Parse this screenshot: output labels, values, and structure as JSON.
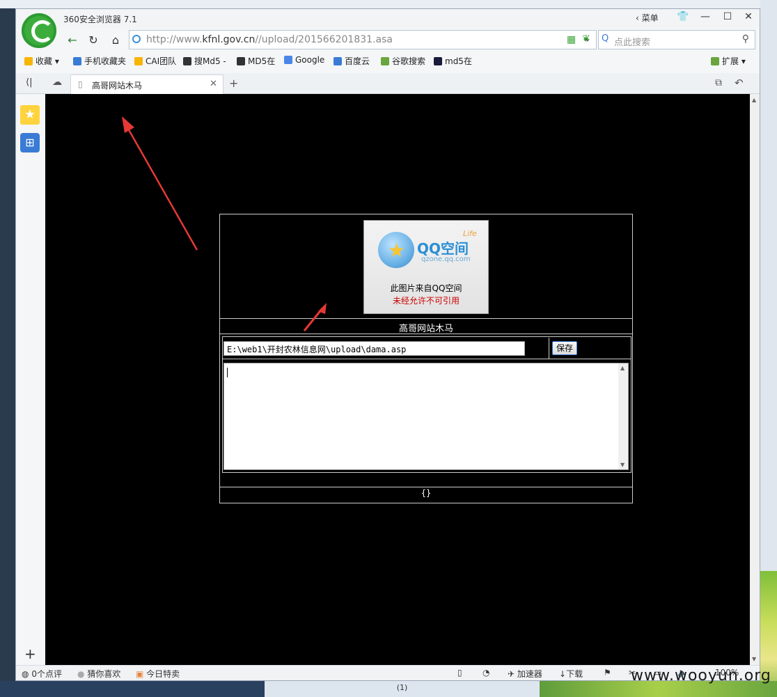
{
  "window": {
    "title": "360安全浏览器 7.1",
    "menu_label": "菜单",
    "controls": {
      "minimize": "—",
      "maximize": "☐",
      "close": "✕"
    }
  },
  "address_bar": {
    "url_prefix": "http://www.",
    "url_domain": "kfnl.gov.cn",
    "url_path": "//upload/201566201831.asa",
    "search_placeholder": "点此搜索"
  },
  "bookmarks": [
    {
      "label": "收藏",
      "icon": "star-icon",
      "color": "#f7b500"
    },
    {
      "label": "手机收藏夹",
      "icon": "phone-icon",
      "color": "#3a7bd5"
    },
    {
      "label": "CAI团队",
      "icon": "badge-icon",
      "color": "#f7b500"
    },
    {
      "label": "搜Md5 -",
      "icon": "new-icon",
      "color": "#333333"
    },
    {
      "label": "MD5在",
      "icon": "new-icon",
      "color": "#333333"
    },
    {
      "label": "Google",
      "icon": "google-icon",
      "color": "#4a86e8"
    },
    {
      "label": "百度云",
      "icon": "cloud-icon",
      "color": "#3a7bd5"
    },
    {
      "label": "谷歌搜索",
      "icon": "leaf-icon",
      "color": "#6aa53e"
    },
    {
      "label": "md5在",
      "icon": "grid-icon",
      "color": "#1a1a3a"
    }
  ],
  "extensions_label": "扩展",
  "tab": {
    "label": "高哥网站木马"
  },
  "page": {
    "qq_logo": "QQ空间",
    "qq_life": "Life",
    "qq_url": "qzone.qq.com",
    "qq_line1": "此图片来自QQ空间",
    "qq_line2": "未经允许不可引用",
    "title": "高哥网站木马",
    "path_value": "E:\\web1\\开封农林信息网\\upload\\dama.asp",
    "save_label": "保存",
    "footer": "{}"
  },
  "status_bar": {
    "reviews": "0个点评",
    "guess": "猜你喜欢",
    "deals": "今日特卖",
    "accelerator": "加速器",
    "download": "下载",
    "zoom": "100%"
  },
  "taskbar_center": "(1)",
  "watermark": "www.wooyun.org"
}
